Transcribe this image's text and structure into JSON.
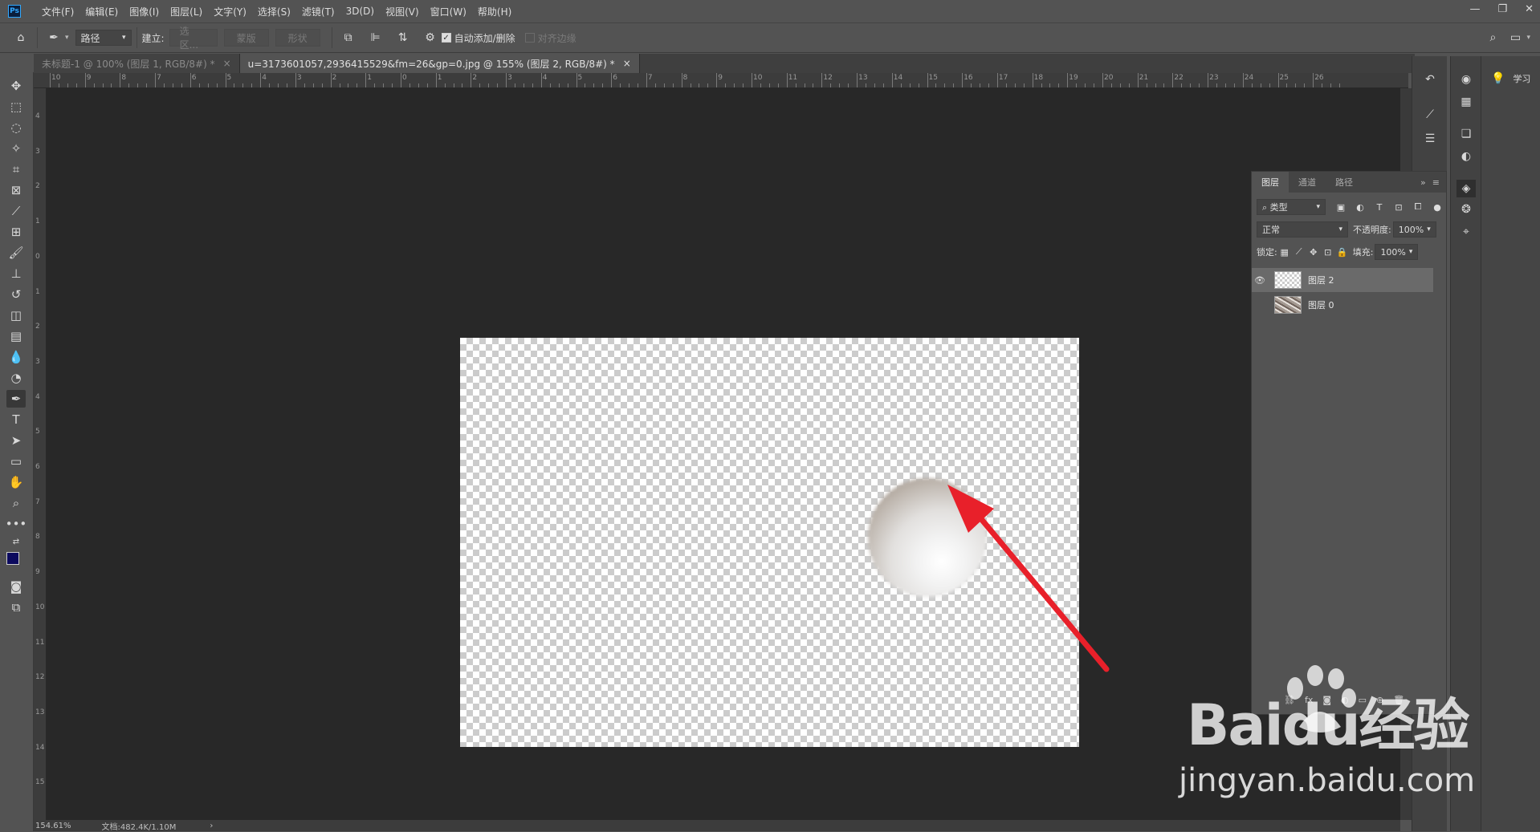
{
  "app": {
    "logo_text": "Ps",
    "menu": [
      "文件(F)",
      "编辑(E)",
      "图像(I)",
      "图层(L)",
      "文字(Y)",
      "选择(S)",
      "滤镜(T)",
      "3D(D)",
      "视图(V)",
      "窗口(W)",
      "帮助(H)"
    ]
  },
  "window_controls": {
    "minimize": "—",
    "restore": "❐",
    "close": "✕"
  },
  "options_bar": {
    "mode_select": "路径",
    "build_label": "建立:",
    "btn_selection": "选区...",
    "btn_mask": "蒙版",
    "btn_shape": "形状",
    "auto_add_delete": "自动添加/删除",
    "align_edges": "对齐边缘"
  },
  "tabs": [
    {
      "label": "未标题-1 @ 100% (图层 1, RGB/8#) *",
      "active": false
    },
    {
      "label": "u=3173601057,2936415529&fm=26&gp=0.jpg @ 155% (图层 2, RGB/8#) *",
      "active": true
    }
  ],
  "ruler_top": [
    "10",
    "9",
    "8",
    "7",
    "6",
    "5",
    "4",
    "3",
    "2",
    "1",
    "0",
    "1",
    "2",
    "3",
    "4",
    "5",
    "6",
    "7",
    "8",
    "9",
    "10",
    "11",
    "12",
    "13",
    "14",
    "15",
    "16",
    "17",
    "18",
    "19",
    "20",
    "21",
    "22",
    "23",
    "24",
    "25",
    "26"
  ],
  "ruler_left": [
    "4",
    "3",
    "2",
    "1",
    "0",
    "1",
    "2",
    "3",
    "4",
    "5",
    "6",
    "7",
    "8",
    "9",
    "10",
    "11",
    "12",
    "13",
    "14",
    "15"
  ],
  "status": {
    "zoom": "154.61%",
    "doc_info": "文档:482.4K/1.10M",
    "arrow": "›"
  },
  "layers_panel": {
    "tabs": [
      "图层",
      "通道",
      "路径"
    ],
    "filter_label": "类型",
    "blend_mode": "正常",
    "opacity_label": "不透明度:",
    "opacity_value": "100%",
    "lock_label": "锁定:",
    "fill_label": "填充:",
    "fill_value": "100%",
    "layers": [
      {
        "name": "图层 2",
        "visible": true,
        "selected": true,
        "thumb": "transparent"
      },
      {
        "name": "图层 0",
        "visible": false,
        "selected": false,
        "thumb": "photo"
      }
    ]
  },
  "learn_panel": {
    "label": "学习"
  },
  "watermark": {
    "brand": "Baidu经验",
    "url": "jingyan.baidu.com"
  },
  "colors": {
    "foreground": "#0c0a5e",
    "background": "#ffffff",
    "arrow": "#e8202a"
  }
}
